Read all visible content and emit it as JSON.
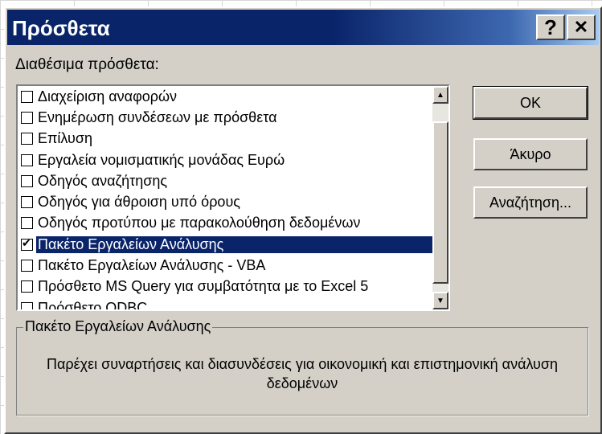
{
  "window": {
    "title": "Πρόσθετα",
    "help_glyph": "?",
    "close_glyph": "✕"
  },
  "list": {
    "label": "Διαθέσιμα πρόσθετα:",
    "items": [
      {
        "label": "Διαχείριση αναφορών",
        "checked": false
      },
      {
        "label": "Ενημέρωση συνδέσεων με πρόσθετα",
        "checked": false
      },
      {
        "label": "Επίλυση",
        "checked": false
      },
      {
        "label": "Εργαλεία νομισματικής μονάδας Ευρώ",
        "checked": false
      },
      {
        "label": "Οδηγός αναζήτησης",
        "checked": false
      },
      {
        "label": "Οδηγός για άθροιση υπό όρους",
        "checked": false
      },
      {
        "label": "Οδηγός προτύπου με παρακολούθηση δεδομένων",
        "checked": false
      },
      {
        "label": "Πακέτο Εργαλείων Ανάλυσης",
        "checked": true,
        "selected": true
      },
      {
        "label": "Πακέτο Εργαλείων Ανάλυσης - VBA",
        "checked": false
      },
      {
        "label": "Πρόσθετο MS Query για συμβατότητα με το Excel 5",
        "checked": false
      },
      {
        "label": "Πρόσθετο ODBC",
        "checked": false
      }
    ]
  },
  "buttons": {
    "ok": "OK",
    "cancel": "Άκυρο",
    "search": "Αναζήτηση..."
  },
  "description": {
    "title": "Πακέτο Εργαλείων Ανάλυσης",
    "text": "Παρέχει συναρτήσεις και διασυνδέσεις για οικονομική και επιστημονική ανάλυση δεδομένων"
  },
  "colors": {
    "titlebar": "#0a246a",
    "selection": "#0a246a",
    "dialog_face": "#d4d0c8"
  }
}
